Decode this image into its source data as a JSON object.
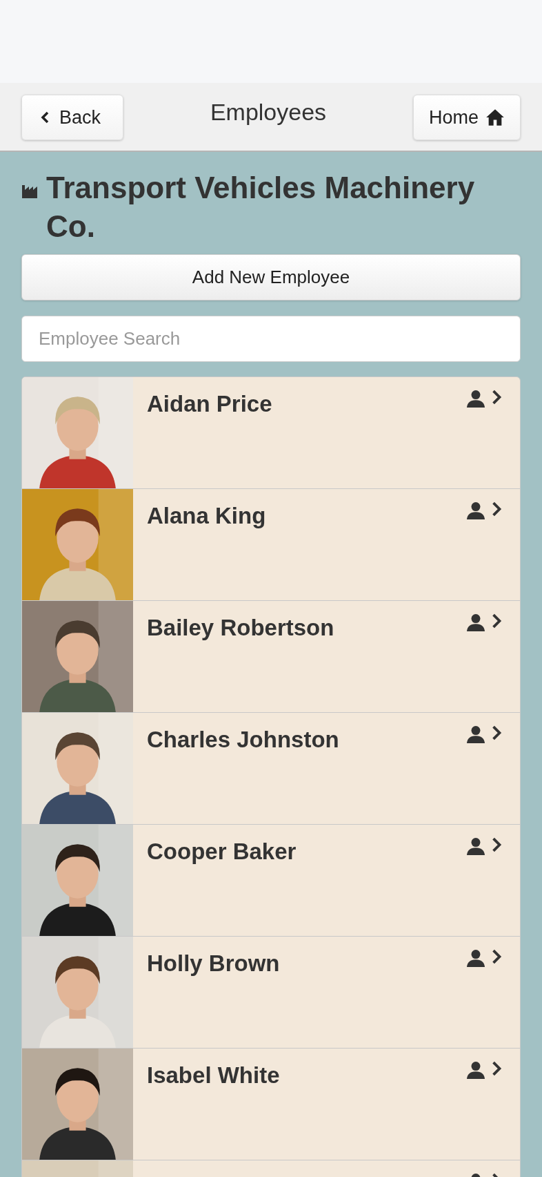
{
  "header": {
    "back": "Back",
    "title": "Employees",
    "home": "Home"
  },
  "company": {
    "name": "Transport Vehicles Machinery Co."
  },
  "add_button": "Add New Employee",
  "search": {
    "placeholder": "Employee Search"
  },
  "employees": [
    {
      "name": "Aidan Price",
      "photo": {
        "kind": "picture"
      }
    },
    {
      "name": "Alana King",
      "photo": {
        "kind": "picture"
      }
    },
    {
      "name": "Bailey Robertson",
      "photo": {
        "kind": "picture"
      }
    },
    {
      "name": "Charles Johnston",
      "photo": {
        "kind": "picture"
      }
    },
    {
      "name": "Cooper Baker",
      "photo": {
        "kind": "picture"
      }
    },
    {
      "name": "Holly Brown",
      "photo": {
        "kind": "picture"
      }
    },
    {
      "name": "Isabel White",
      "photo": {
        "kind": "picture"
      }
    },
    {
      "photo": {
        "kind": "picture"
      }
    }
  ]
}
